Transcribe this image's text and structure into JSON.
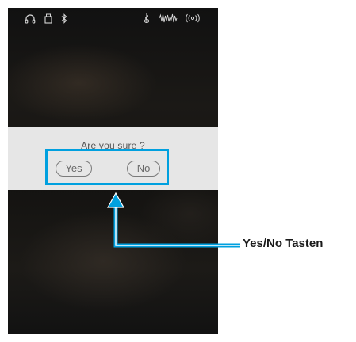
{
  "status_bar": {
    "icons": [
      "headphones-icon",
      "usb-icon",
      "bluetooth-icon",
      "metronome-icon",
      "sound-wave-icon",
      "speaker-icon"
    ]
  },
  "dialog": {
    "title": "Are you sure ?",
    "yes_label": "Yes",
    "no_label": "No"
  },
  "callout": {
    "label": "Yes/No Tasten",
    "color": "#00a0df"
  }
}
